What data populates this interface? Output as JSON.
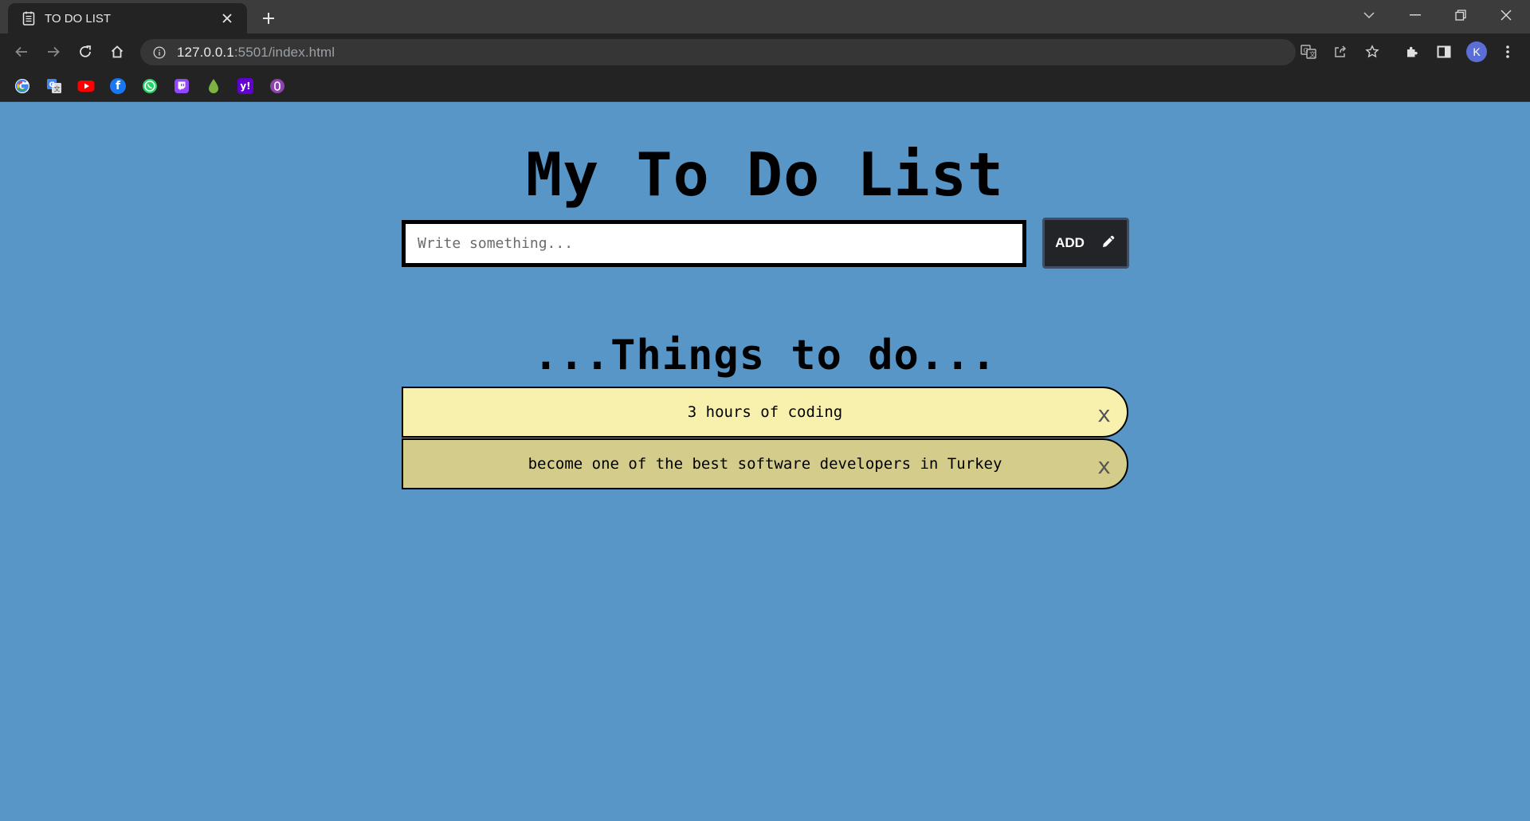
{
  "browser": {
    "tab_title": "TO DO LIST",
    "url_host": "127.0.0.1",
    "url_path": ":5501/index.html",
    "profile_initial": "K",
    "bookmark_icons": [
      "google-icon",
      "google-translate-icon",
      "youtube-icon",
      "facebook-icon",
      "whatsapp-icon",
      "twitch-icon",
      "droplet-icon",
      "yahoo-icon",
      "purple-circle-icon"
    ]
  },
  "page": {
    "background_color": "#5796c7",
    "title": "My To Do List",
    "input_placeholder": "Write something...",
    "add_label": "ADD",
    "section_heading": "...Things to do...",
    "todos": [
      {
        "text": "3 hours of coding",
        "color": "#f8f1ad",
        "delete_label": "x"
      },
      {
        "text": "become one of the best software developers in Turkey",
        "color": "#d4cc8b",
        "delete_label": "x"
      }
    ]
  }
}
